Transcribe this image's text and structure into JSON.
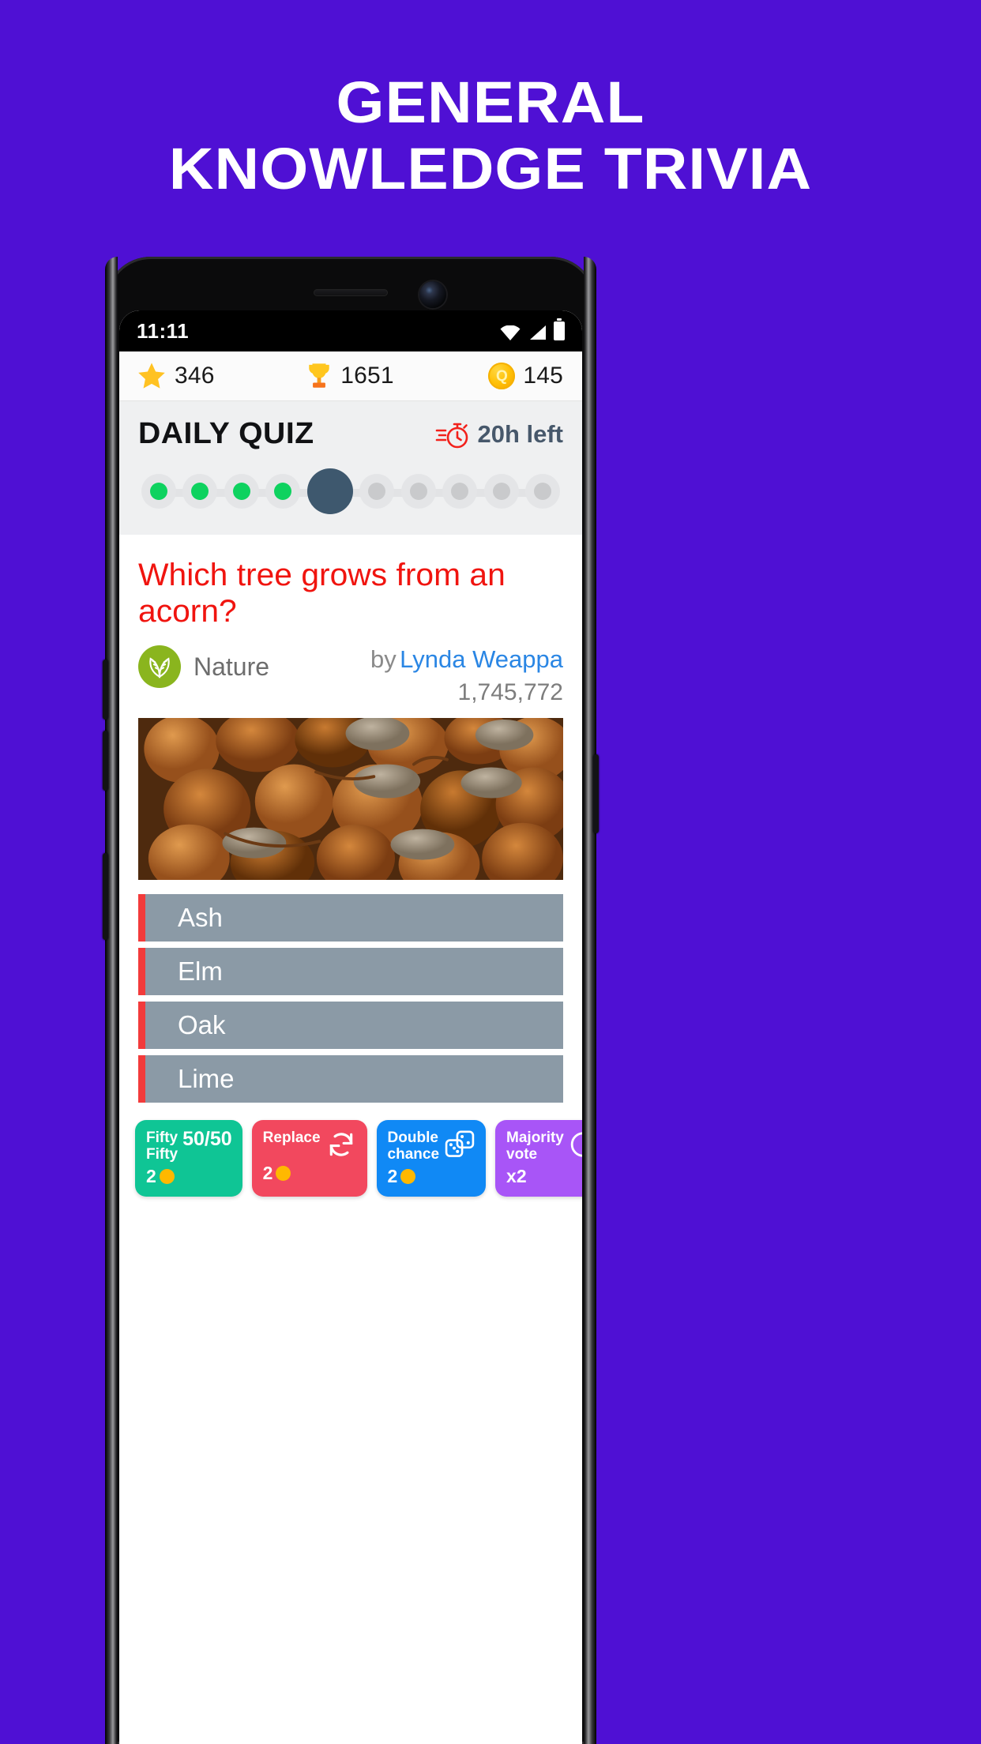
{
  "promo": {
    "line1": "GENERAL",
    "line2": "KNOWLEDGE TRIVIA",
    "background_color": "#4f10d4",
    "text_color": "#ffffff"
  },
  "statusbar": {
    "time": "11:11",
    "icons": [
      "wifi-icon",
      "signal-icon",
      "battery-icon"
    ]
  },
  "stats": {
    "star": {
      "icon": "star-icon",
      "value": "346"
    },
    "trophy": {
      "icon": "trophy-icon",
      "value": "1651"
    },
    "coin": {
      "icon": "coin-icon",
      "glyph": "Q",
      "value": "145"
    }
  },
  "quiz_header": {
    "title": "DAILY QUIZ",
    "timer_icon": "stopwatch-icon",
    "timer_text": "20h left",
    "progress": {
      "total": 10,
      "completed": 4,
      "current_index": 5,
      "done_color": "#0ed25f",
      "current_color": "#3e586e",
      "pending_color": "#c9cacc"
    }
  },
  "question": {
    "text": "Which tree grows from an acorn?",
    "text_color": "#f0140f",
    "category": {
      "icon": "leaf-icon",
      "name": "Nature",
      "badge_color": "#8ab51e"
    },
    "author": {
      "prefix": "by",
      "name": "Lynda Weappa",
      "link_color": "#2a86e4"
    },
    "plays": "1,745,772",
    "image_alt": "acorns-photo"
  },
  "answers": [
    {
      "label": "Ash"
    },
    {
      "label": "Elm"
    },
    {
      "label": "Oak"
    },
    {
      "label": "Lime"
    }
  ],
  "answer_style": {
    "fill": "#8b9aa6",
    "stripe": "#f23b3b",
    "text": "#ffffff"
  },
  "powerups": [
    {
      "label_line1": "Fifty",
      "label_line2": "Fifty",
      "big": "50/50",
      "icon": "fifty-fifty-icon",
      "cost": "2",
      "color": "#0fc595"
    },
    {
      "label_line1": "Replace",
      "label_line2": "",
      "big": "",
      "icon": "refresh-icon",
      "cost": "2",
      "color": "#f2485e"
    },
    {
      "label_line1": "Double",
      "label_line2": "chance",
      "big": "",
      "icon": "dice-icon",
      "cost": "2",
      "color": "#1089f5"
    },
    {
      "label_line1": "Majority",
      "label_line2": "vote",
      "big": "",
      "icon": "pie-chart-icon",
      "cost": "x2",
      "color": "#a855f7"
    }
  ]
}
